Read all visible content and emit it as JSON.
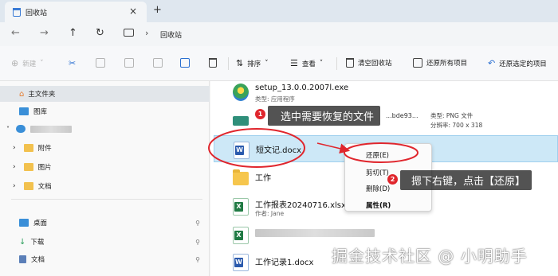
{
  "window": {
    "tab_title": "回收站",
    "close_glyph": "×",
    "new_tab_glyph": "+"
  },
  "addressbar": {
    "path_label": "回收站"
  },
  "toolbar": {
    "new_label": "新建",
    "sort_label": "排序",
    "view_label": "查看",
    "empty_bin_label": "清空回收站",
    "restore_all_label": "还原所有项目",
    "restore_selected_label": "还原选定的项目"
  },
  "sidebar": {
    "home_label": "主文件夹",
    "gallery_label": "图库",
    "attachments_label": "附件",
    "pictures_label": "图片",
    "documents_label": "文档",
    "desktop_label": "桌面",
    "downloads_label": "下载",
    "documents2_label": "文档"
  },
  "files": [
    {
      "name": "setup_13.0.0.2007l.exe",
      "sub": "类型: 应用程序",
      "icon": "setup-icon"
    },
    {
      "name": "...bde93...",
      "sub": "",
      "icon": "image-icon"
    },
    {
      "name": "短文记.docx",
      "sub": "",
      "icon": "word-icon"
    },
    {
      "name": "工作",
      "sub": "",
      "icon": "folder-icon"
    },
    {
      "name": "工作报表20240716.xlsx",
      "sub": "作者: Jane",
      "icon": "excel-icon"
    },
    {
      "name": "",
      "sub": "",
      "icon": "excel-icon"
    },
    {
      "name": "工作记录1.docx",
      "sub": "",
      "icon": "word-icon"
    }
  ],
  "details": {
    "type_text": "类型: PNG 文件",
    "resolution_text": "分辨率: 700 x 318"
  },
  "context_menu": {
    "restore": "还原(E)",
    "cut": "剪切(T)",
    "delete": "删除(D)",
    "properties": "属性(R)"
  },
  "annotations": {
    "step1_number": "1",
    "step1_text": "选中需要恢复的文件",
    "step2_number": "2",
    "step2_text": "摁下右键，点击【还原】"
  },
  "watermark": "掘金技术社区 @ 小明助手",
  "colors": {
    "annotation_red": "#e0262d",
    "selection_blue": "#cde8f7"
  }
}
